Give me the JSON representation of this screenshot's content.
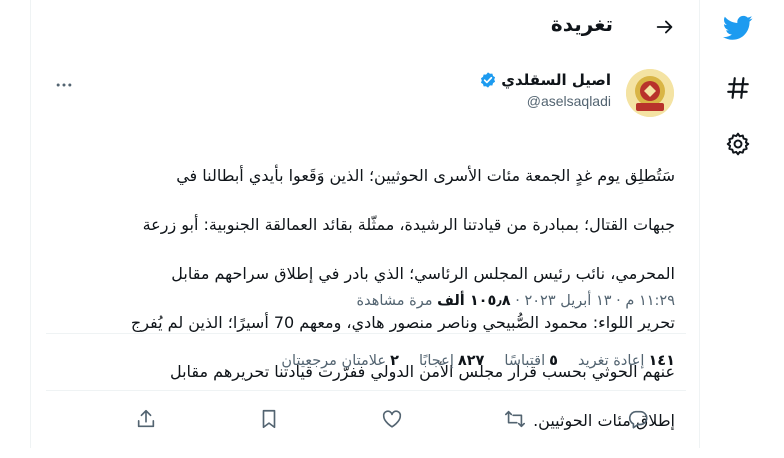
{
  "header": {
    "title": "تغريدة"
  },
  "tweet": {
    "display_name": "اصيل السقلدي",
    "handle": "@aselsaqladi",
    "lines": [
      "سَتُطلِق يوم غدٍ الجمعة مئات الأسرى الحوثيين؛ الذين وَقَعوا بأيدي أبطالنا في",
      "جبهات القتال؛ بمبادرة من قيادتنا الرشيدة، ممثّلة بقائد العمالقة الجنوبية: أبو زرعة",
      "المحرمي، نائب رئيس المجلس الرئاسي؛ الذي بادر في إطلاق سراحهم مقابل",
      "تحرير اللواء: محمود الصُّبيحي وناصر منصور هادي، ومعهم 70 أسيرًا؛ الذين لم يُفرج",
      "عنهم الحوثي بحسب قرار مجلس الأمن الدولي ففرّرت قيادتنا تحريرهم مقابل",
      "إطلاق مئات الحوثيين."
    ],
    "time": "١١:٢٩ م",
    "date": "١٣ أبريل ٢٠٢٣",
    "views_count": "١٠٥٫٨ ألف",
    "views_label": "مرة مشاهدة"
  },
  "stats": {
    "retweets_count": "١٤١",
    "retweets_label": "إعادة تغريد",
    "quotes_count": "٥",
    "quotes_label": "اقتباسًا",
    "likes_count": "٨٢٧",
    "likes_label": "إعجابًا",
    "bookmarks_count": "٢",
    "bookmarks_label": "علامتان مرجعيتان"
  },
  "colors": {
    "accent": "#1d9bf0",
    "text": "#0f1419",
    "muted": "#536471",
    "border": "#eff3f4"
  },
  "icons": {
    "rail": [
      "twitter-bird-icon",
      "hashtag-icon",
      "gear-icon"
    ],
    "actions": [
      "share-icon",
      "bookmark-icon",
      "heart-icon",
      "retweet-icon",
      "reply-icon"
    ]
  }
}
